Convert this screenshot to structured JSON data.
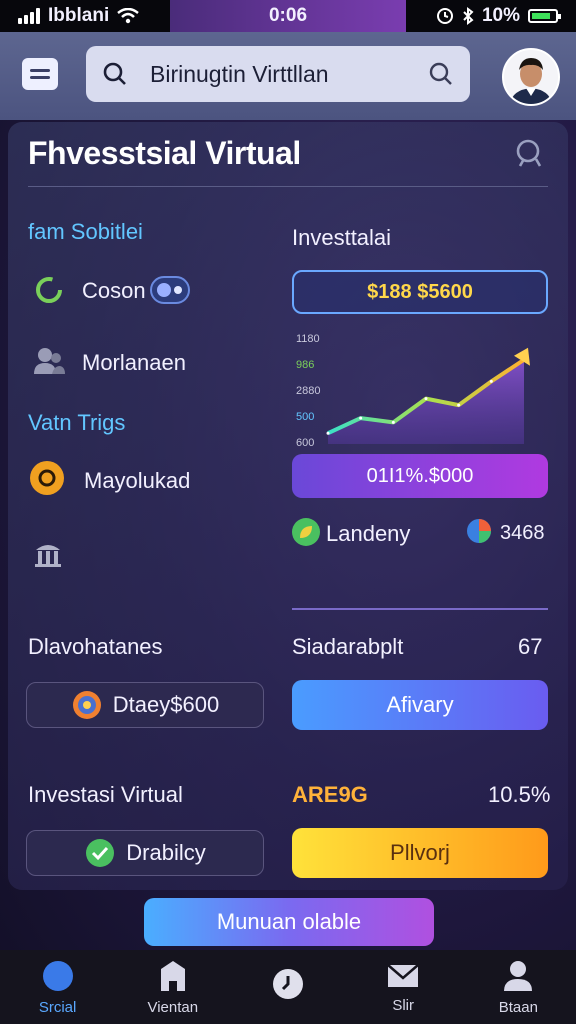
{
  "status": {
    "carrier": "Ibblani",
    "time": "0:06",
    "battery": "10%"
  },
  "header": {
    "search_text": "Birinugtin Virttllan"
  },
  "main": {
    "title": "Fhvesstsial Virtual",
    "left": {
      "section1": "fam Sobitlei",
      "item1": "Coson",
      "item2": "Morlanaen",
      "section2": "Vatn Trigs",
      "item3": "Mayolukad"
    },
    "right": {
      "chart_label": "Investtalai",
      "price_box": "$188 $5600",
      "purple_box": "01I1%.$000",
      "stat1": "Landeny",
      "stat2": "3468"
    },
    "row1": {
      "left_label": "Dlavohatanes",
      "right_label": "Siadarabplt",
      "right_value": "67"
    },
    "row1_buttons": {
      "left": "Dtaey$600",
      "right": "Afivary"
    },
    "row2": {
      "left_label": "Investasi Virtual",
      "middle_label": "ARE9G",
      "right_value": "10.5%"
    },
    "row2_buttons": {
      "left": "Drabilcy",
      "right": "Pllvorj"
    },
    "bottom_button": "Munuan olable"
  },
  "chart_data": {
    "type": "area",
    "y_ticks": [
      "1180",
      "986",
      "2880",
      "500",
      "600"
    ],
    "x": [
      0,
      1,
      2,
      3,
      4,
      5,
      6
    ],
    "y": [
      10,
      24,
      20,
      42,
      36,
      58,
      78
    ],
    "ylim": [
      0,
      100
    ]
  },
  "nav": [
    {
      "label": "Srcial",
      "icon": "compass-icon"
    },
    {
      "label": "Vientan",
      "icon": "building-icon"
    },
    {
      "label": "",
      "icon": "clock-icon"
    },
    {
      "label": "Slir",
      "icon": "mail-icon"
    },
    {
      "label": "Btaan",
      "icon": "person-icon"
    }
  ],
  "colors": {
    "accent": "#62c6ff",
    "gold": "#ffd84a",
    "purple": "#b03ae0"
  }
}
